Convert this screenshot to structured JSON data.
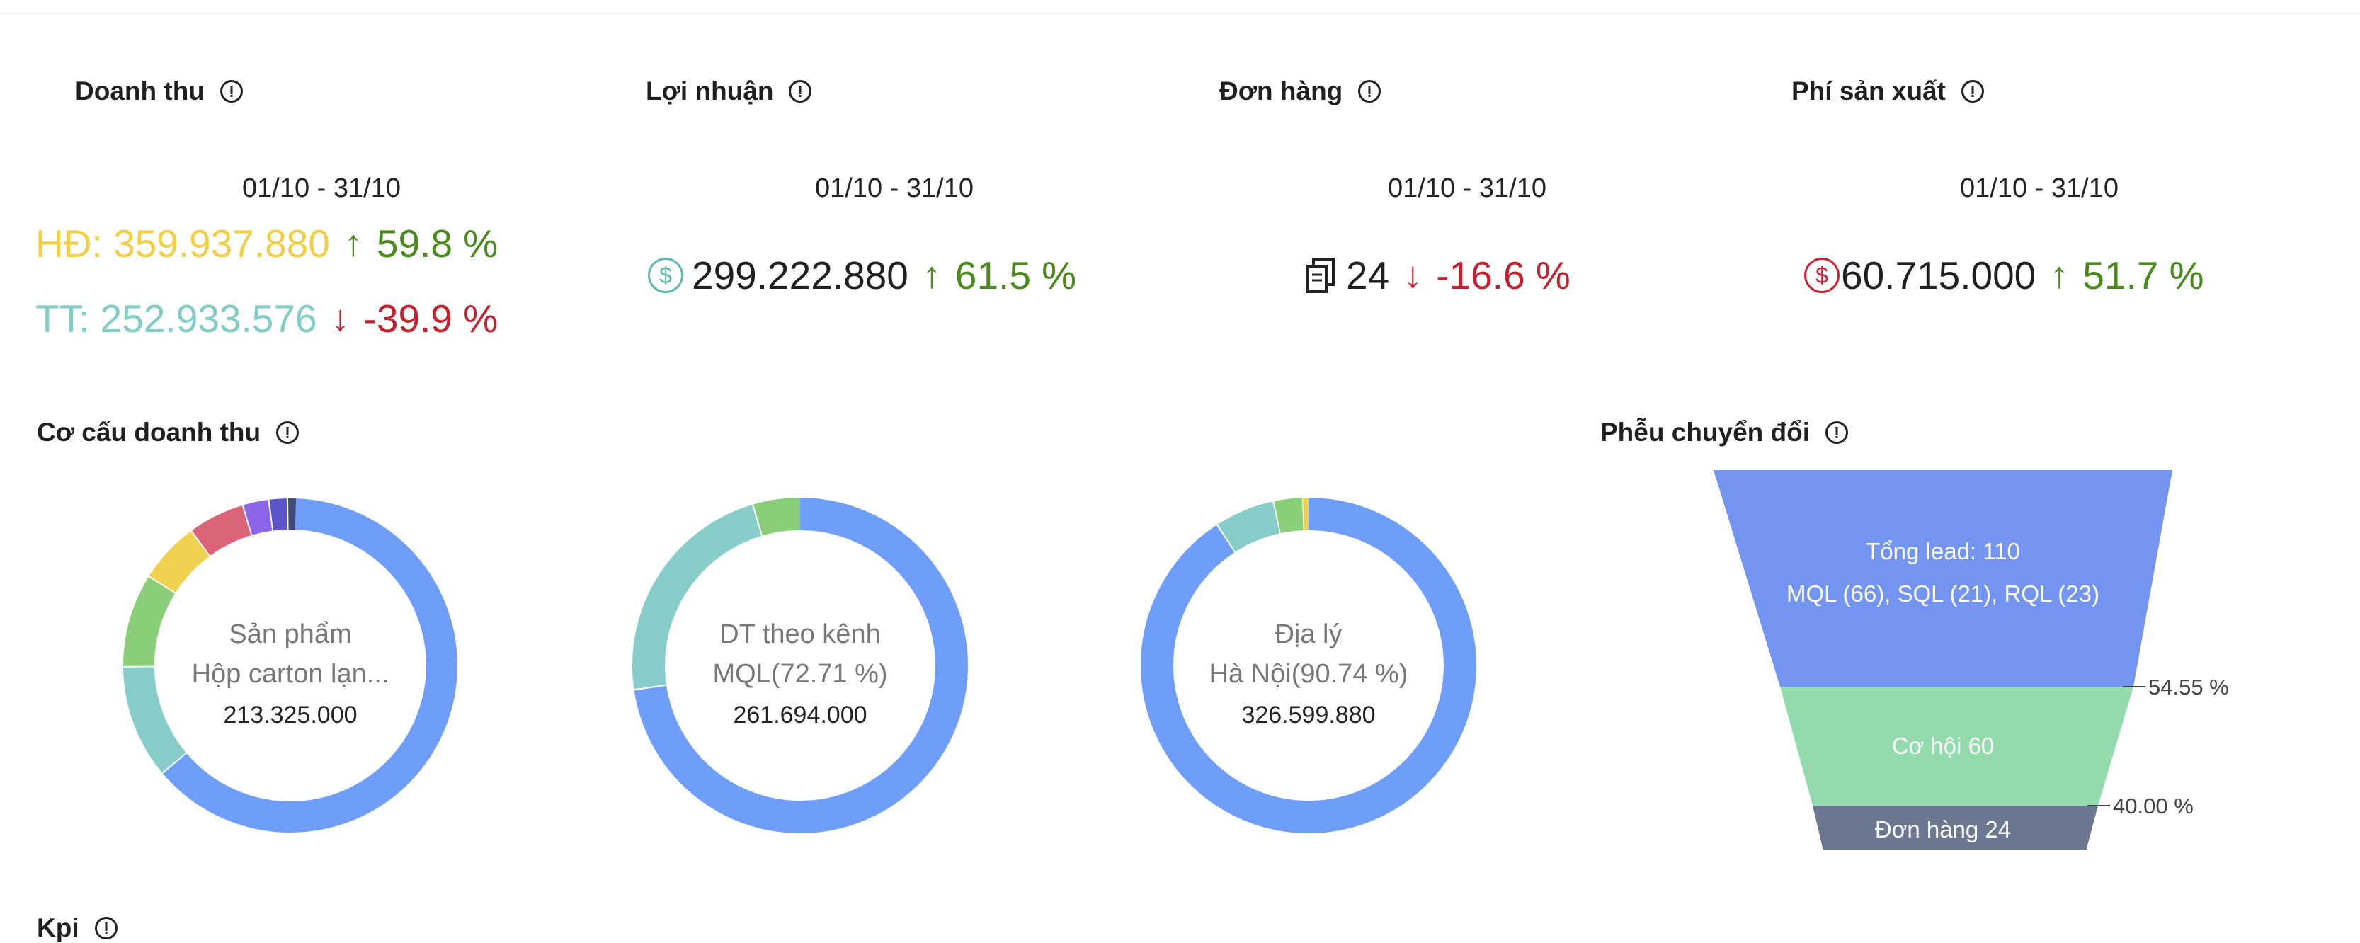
{
  "kpis": [
    {
      "title": "Doanh thu",
      "period": "01/10 - 31/10",
      "hd_label": "HĐ: 359.937.880",
      "hd_change": "59.8 %",
      "hd_dir": "up",
      "tt_label": "TT: 252.933.576",
      "tt_change": "-39.9 %",
      "tt_dir": "down"
    },
    {
      "title": "Lợi nhuận",
      "period": "01/10 - 31/10",
      "value": "299.222.880",
      "change": "61.5 %",
      "dir": "up",
      "icon": "dollar-circle-icon"
    },
    {
      "title": "Đơn hàng",
      "period": "01/10 - 31/10",
      "value": "24",
      "change": "-16.6 %",
      "dir": "down",
      "icon": "document-copy-icon"
    },
    {
      "title": "Phí sản xuất",
      "period": "01/10 - 31/10",
      "value": "60.715.000",
      "change": "51.7 %",
      "dir": "up",
      "icon": "dollar-circle-icon"
    }
  ],
  "revenue_structure": {
    "title": "Cơ cấu doanh thu",
    "donuts": [
      {
        "line1": "Sản phẩm",
        "line2": "Hộp carton lạn...",
        "line3": "213.325.000"
      },
      {
        "line1": "DT theo kênh",
        "line2": "MQL(72.71 %)",
        "line3": "261.694.000"
      },
      {
        "line1": "Địa lý",
        "line2": "Hà Nội(90.74 %)",
        "line3": "326.599.880"
      }
    ]
  },
  "funnel": {
    "title": "Phễu chuyển đổi",
    "top_line1": "Tổng lead: 110",
    "top_line2": "MQL (66), SQL (21), RQL (23)",
    "mid": "Cơ hội 60",
    "bottom": "Đơn hàng 24",
    "pct1": "54.55 %",
    "pct2": "40.00 %"
  },
  "bottom_section": {
    "title": "Kpi"
  },
  "colors": {
    "blue": "#6e9ef9",
    "teal": "#86cdc9",
    "green": "#8bce7a",
    "yellow": "#f0d04f",
    "red": "#dc6478",
    "purple": "#8c66e8",
    "indigo": "#5b55c9",
    "navy": "#3f4a78",
    "funnel_top": "#7494f2",
    "funnel_mid": "#93dbac",
    "funnel_bottom": "#6c7891"
  }
}
